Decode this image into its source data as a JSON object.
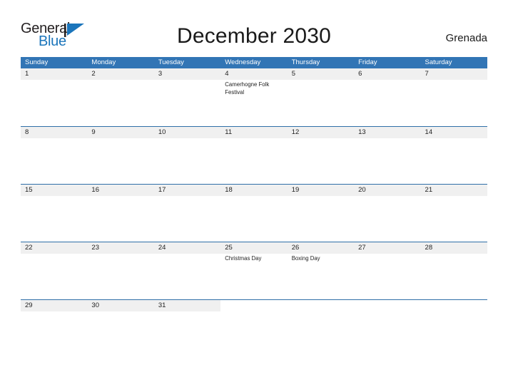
{
  "brand": {
    "name_part1": "General",
    "name_part2": "Blue",
    "flag_icon": "triangle-flag-icon",
    "color_dark": "#231f20",
    "color_blue": "#1b75bb"
  },
  "header": {
    "title": "December 2030",
    "location": "Grenada"
  },
  "colors": {
    "header_blue": "#3275b5",
    "row_divider": "#2f6fa8",
    "date_band": "#f0f0f0",
    "text": "#222222"
  },
  "calendar": {
    "weekdays": [
      "Sunday",
      "Monday",
      "Tuesday",
      "Wednesday",
      "Thursday",
      "Friday",
      "Saturday"
    ],
    "weeks": [
      {
        "days": [
          {
            "number": "1",
            "events": []
          },
          {
            "number": "2",
            "events": []
          },
          {
            "number": "3",
            "events": []
          },
          {
            "number": "4",
            "events": [
              "Camerhogne Folk Festival"
            ]
          },
          {
            "number": "5",
            "events": []
          },
          {
            "number": "6",
            "events": []
          },
          {
            "number": "7",
            "events": []
          }
        ]
      },
      {
        "days": [
          {
            "number": "8",
            "events": []
          },
          {
            "number": "9",
            "events": []
          },
          {
            "number": "10",
            "events": []
          },
          {
            "number": "11",
            "events": []
          },
          {
            "number": "12",
            "events": []
          },
          {
            "number": "13",
            "events": []
          },
          {
            "number": "14",
            "events": []
          }
        ]
      },
      {
        "days": [
          {
            "number": "15",
            "events": []
          },
          {
            "number": "16",
            "events": []
          },
          {
            "number": "17",
            "events": []
          },
          {
            "number": "18",
            "events": []
          },
          {
            "number": "19",
            "events": []
          },
          {
            "number": "20",
            "events": []
          },
          {
            "number": "21",
            "events": []
          }
        ]
      },
      {
        "days": [
          {
            "number": "22",
            "events": []
          },
          {
            "number": "23",
            "events": []
          },
          {
            "number": "24",
            "events": []
          },
          {
            "number": "25",
            "events": [
              "Christmas Day"
            ]
          },
          {
            "number": "26",
            "events": [
              "Boxing Day"
            ]
          },
          {
            "number": "27",
            "events": []
          },
          {
            "number": "28",
            "events": []
          }
        ]
      },
      {
        "days": [
          {
            "number": "29",
            "events": []
          },
          {
            "number": "30",
            "events": []
          },
          {
            "number": "31",
            "events": []
          },
          {
            "number": "",
            "events": []
          },
          {
            "number": "",
            "events": []
          },
          {
            "number": "",
            "events": []
          },
          {
            "number": "",
            "events": []
          }
        ]
      }
    ]
  }
}
